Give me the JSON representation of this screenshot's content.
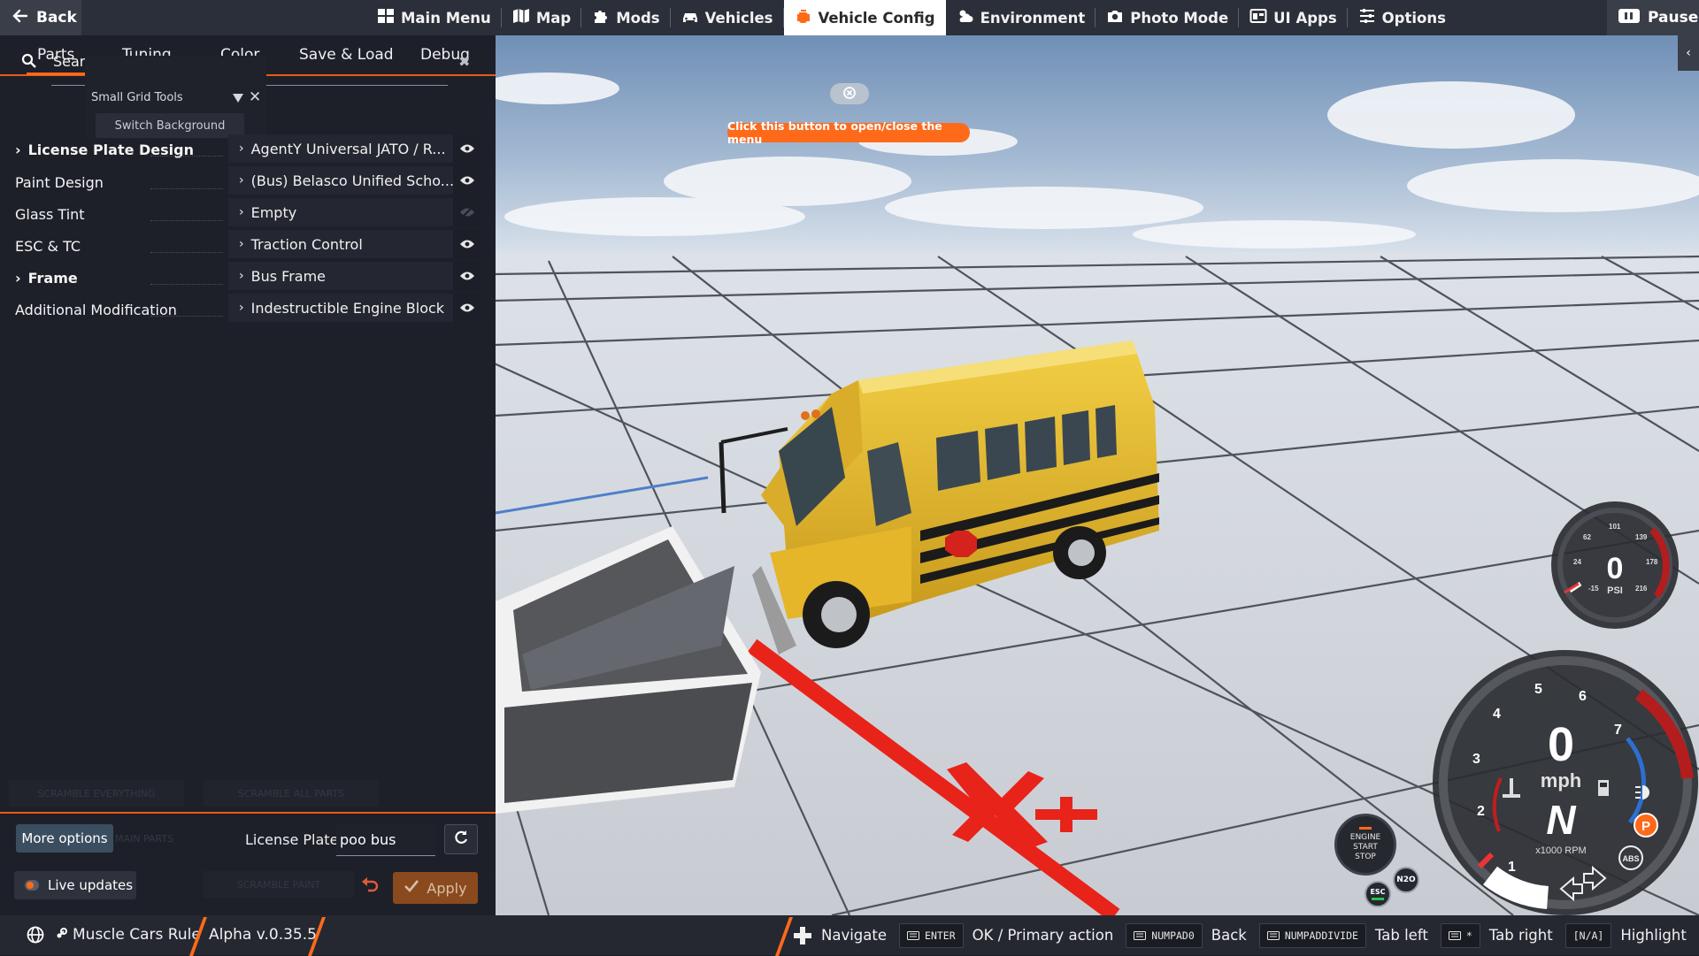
{
  "topbar": {
    "back_label": "Back",
    "pause_label": "Pause",
    "nav": [
      {
        "label": "Main Menu",
        "icon": "main-menu-icon"
      },
      {
        "label": "Map",
        "icon": "map-icon"
      },
      {
        "label": "Mods",
        "icon": "puzzle-icon"
      },
      {
        "label": "Vehicles",
        "icon": "car-icon"
      },
      {
        "label": "Vehicle Config",
        "icon": "engine-icon",
        "active": true
      },
      {
        "label": "Environment",
        "icon": "weather-icon"
      },
      {
        "label": "Photo Mode",
        "icon": "camera-icon"
      },
      {
        "label": "UI Apps",
        "icon": "ui-apps-icon"
      },
      {
        "label": "Options",
        "icon": "sliders-icon"
      }
    ]
  },
  "panel": {
    "tabs": [
      "Parts",
      "Tuning",
      "Color",
      "Save & Load",
      "Debug"
    ],
    "active_tab": "Parts",
    "search_text": "Searc",
    "tooltip": {
      "title": "Small Grid Tools",
      "button": "Switch Background"
    },
    "parts": [
      {
        "slot": "License Plate Design",
        "value": "AgentY Universal JATO / R...",
        "expandable": true,
        "bold": true,
        "visible": true
      },
      {
        "slot": "Paint Design",
        "value": "(Bus) Belasco Unified Scho...",
        "expandable": false,
        "bold": false,
        "visible": true
      },
      {
        "slot": "Glass Tint",
        "value": "Empty",
        "expandable": false,
        "bold": false,
        "visible": false
      },
      {
        "slot": "ESC & TC",
        "value": "Traction Control",
        "expandable": false,
        "bold": false,
        "visible": true
      },
      {
        "slot": "Frame",
        "value": "Bus Frame",
        "expandable": true,
        "bold": true,
        "visible": true
      },
      {
        "slot": "Additional Modification",
        "value": "Indestructible Engine Block",
        "expandable": false,
        "bold": false,
        "visible": true
      }
    ],
    "faint_buttons": [
      "SCRAMBLE EVERYTHING",
      "SCRAMBLE ALL PARTS",
      "MAIN PARTS",
      "SCRAMBLE PAINT"
    ],
    "more_options": "More options",
    "license_plate_label": "License Plate",
    "license_plate_value": "poo bus",
    "live_updates": "Live updates",
    "apply": "Apply"
  },
  "viewport": {
    "hint": "Click this button to open/close the menu"
  },
  "gauges": {
    "boost_value": "0",
    "boost_unit": "PSI",
    "boost_ticks": [
      "-15",
      "24",
      "62",
      "101",
      "139",
      "178",
      "216"
    ],
    "speed_value": "0",
    "speed_unit": "mph",
    "gear": "N",
    "rpm_label": "x1000 RPM",
    "rpm_ticks": [
      "1",
      "2",
      "3",
      "4",
      "5",
      "6",
      "7"
    ],
    "engine_button": [
      "ENGINE",
      "START",
      "STOP"
    ],
    "nos_label": "N2O",
    "esc_label": "ESC",
    "abs_label": "ABS",
    "parking_label": "P"
  },
  "bottombar": {
    "server_name": "Muscle Cars Rule",
    "version": "Alpha v.0.35.5",
    "hints": [
      {
        "key": "",
        "label": "Navigate",
        "icon": "dpad-icon"
      },
      {
        "key": "ENTER",
        "label": "OK / Primary action",
        "icon": "keyboard-icon"
      },
      {
        "key": "NUMPAD0",
        "label": "Back",
        "icon": "keyboard-icon"
      },
      {
        "key": "NUMPADDIVIDE",
        "label": "Tab left",
        "icon": "keyboard-icon"
      },
      {
        "key": "*",
        "label": "Tab right",
        "icon": "keyboard-icon"
      },
      {
        "key": "[N/A]",
        "label": "Highlight",
        "icon": ""
      }
    ]
  },
  "colors": {
    "accent": "#ff6a1a",
    "panel_bg": "#1d2029",
    "topbar_bg": "#2b2f39",
    "bus_yellow": "#e8b92a"
  }
}
